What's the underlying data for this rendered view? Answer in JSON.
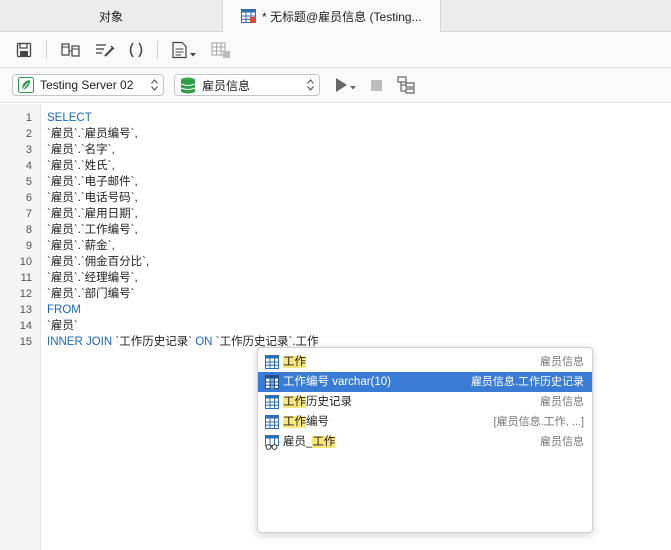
{
  "tabs": [
    {
      "label": "对象"
    },
    {
      "label": "* 无标题@雇员信息 (Testing..."
    }
  ],
  "connection": {
    "server": "Testing Server 02",
    "database": "雇员信息"
  },
  "editor": {
    "lines": [
      {
        "number": "1",
        "text": "SELECT"
      },
      {
        "number": "2",
        "text": "`雇员`.`雇员编号`,"
      },
      {
        "number": "3",
        "text": "`雇员`.`名字`,"
      },
      {
        "number": "4",
        "text": "`雇员`.`姓氏`,"
      },
      {
        "number": "5",
        "text": "`雇员`.`电子邮件`,"
      },
      {
        "number": "6",
        "text": "`雇员`.`电话号码`,"
      },
      {
        "number": "7",
        "text": "`雇员`.`雇用日期`,"
      },
      {
        "number": "8",
        "text": "`雇员`.`工作编号`,"
      },
      {
        "number": "9",
        "text": "`雇员`.`薪金`,"
      },
      {
        "number": "10",
        "text": "`雇员`.`佣金百分比`,"
      },
      {
        "number": "11",
        "text": "`雇员`.`经理编号`,"
      },
      {
        "number": "12",
        "text": "`雇员`.`部门编号`"
      },
      {
        "number": "13",
        "text": "FROM"
      },
      {
        "number": "14",
        "text": "`雇员`"
      },
      {
        "number": "15",
        "kw1": "INNER JOIN",
        "mid": " `工作历史记录` ",
        "kw2": "ON",
        "tail": " `工作历史记录`.工作"
      }
    ]
  },
  "autocomplete": {
    "items": [
      {
        "hl": "工作",
        "rest": "",
        "detail": "雇员信息",
        "icon": "table-icon"
      },
      {
        "hl": "",
        "rest": "工作编号 varchar(10)",
        "detail": "雇员信息.工作历史记录",
        "icon": "column-icon",
        "selected": true
      },
      {
        "hl": "工作",
        "rest": "历史记录",
        "detail": "雇员信息",
        "icon": "table-icon"
      },
      {
        "hl": "工作",
        "rest": "编号",
        "detail": "[雇员信息.工作, ...]",
        "icon": "table-icon"
      },
      {
        "pre": "雇员_",
        "hl": "工作",
        "rest": "",
        "detail": "雇员信息",
        "icon": "view-icon"
      }
    ]
  },
  "colors": {
    "keyword": "#1769c8",
    "selection": "#3a7bd5",
    "match_highlight": "#f8e77a"
  }
}
